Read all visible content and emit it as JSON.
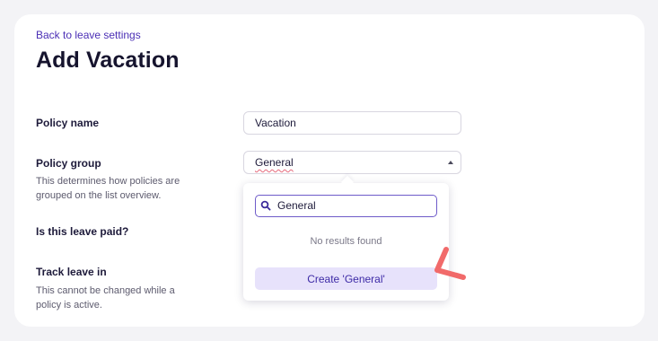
{
  "header": {
    "back_link": "Back to leave settings",
    "title": "Add Vacation"
  },
  "form": {
    "policy_name": {
      "label": "Policy name",
      "value": "Vacation"
    },
    "policy_group": {
      "label": "Policy group",
      "help": "This determines how policies are grouped on the list overview.",
      "selected": "General"
    },
    "paid": {
      "label": "Is this leave paid?"
    },
    "track": {
      "label": "Track leave in",
      "help": "This cannot be changed while a policy is active."
    }
  },
  "dropdown": {
    "search_value": "General",
    "empty_text": "No results found",
    "create_label": "Create 'General'"
  },
  "icons": {
    "search": "search-icon",
    "caret": "caret-up-icon",
    "annotation": "pointer-arrow-icon"
  },
  "colors": {
    "accent": "#4b2fb5",
    "button_bg": "#e7e2fb",
    "annotation": "#f16a6a"
  }
}
